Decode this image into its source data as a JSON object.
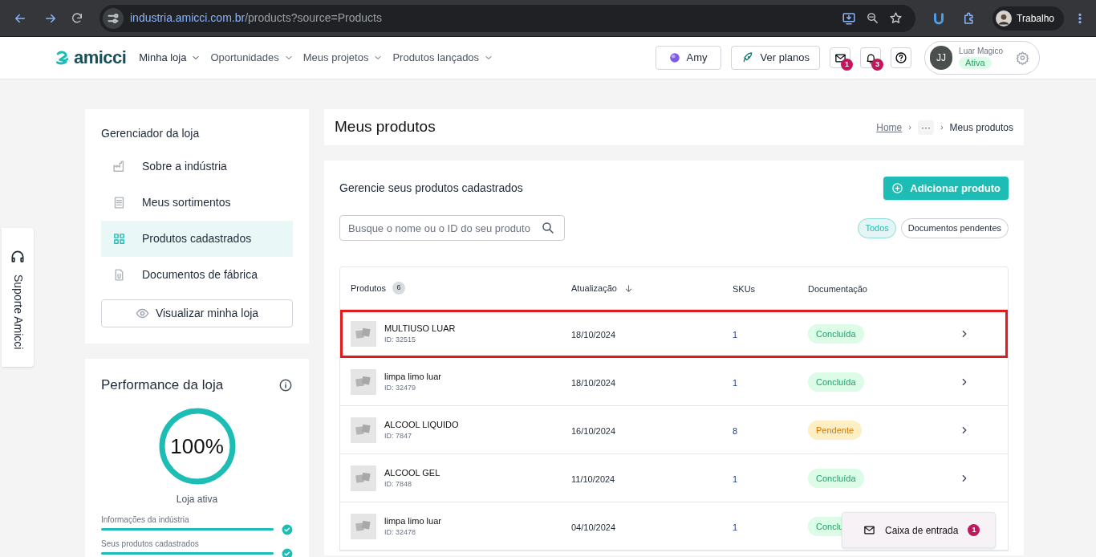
{
  "browser": {
    "url_host": "industria.amicci.com.br",
    "url_path": "/products?source=Products",
    "profile": "Trabalho"
  },
  "header": {
    "logo": "amicci",
    "nav": [
      {
        "label": "Minha loja",
        "selected": true
      },
      {
        "label": "Oportunidades",
        "selected": false
      },
      {
        "label": "Meus projetos",
        "selected": false
      },
      {
        "label": "Produtos lançados",
        "selected": false
      }
    ],
    "amy_button": "Amy",
    "plans_button": "Ver planos",
    "mail_badge": "1",
    "bell_badge": "3",
    "user": {
      "initials": "JJ",
      "name": "Luar Magico",
      "status": "Ativa"
    }
  },
  "support_tab": "Suporte Amicci",
  "store_manager": {
    "title": "Gerenciador da loja",
    "items": [
      {
        "label": "Sobre a indústria",
        "selected": false
      },
      {
        "label": "Meus sortimentos",
        "selected": false
      },
      {
        "label": "Produtos cadastrados",
        "selected": true
      },
      {
        "label": "Documentos de fábrica",
        "selected": false
      }
    ],
    "view_button": "Visualizar minha loja"
  },
  "performance": {
    "title": "Performance da loja",
    "percent": "100%",
    "caption": "Loja ativa",
    "items": [
      {
        "label": "Informações da indústria",
        "level": 1,
        "checked": true
      },
      {
        "label": "Seus produtos cadastrados",
        "level": 1,
        "checked": true
      }
    ]
  },
  "page": {
    "title": "Meus produtos",
    "breadcrumb": [
      "Home",
      "›",
      "···",
      "›",
      "Meus produtos"
    ]
  },
  "products": {
    "subtitle": "Gerencie seus produtos cadastrados",
    "add_button": "Adicionar produto",
    "search": {
      "placeholder": "Busque o nome ou o ID do seu produto"
    },
    "filters": [
      {
        "label": "Todos",
        "selected": true
      },
      {
        "label": "Documentos pendentes",
        "selected": false
      }
    ],
    "table": {
      "columns": [
        "Produtos",
        "Atualização",
        "SKUs",
        "Documentação"
      ],
      "count": "6",
      "rows": [
        {
          "name": "MULTIUSO LUAR",
          "id": "ID: 32515",
          "date": "18/10/2024",
          "skus": "1",
          "status": "Concluída",
          "kind": "done",
          "highlighted": true
        },
        {
          "name": "limpa limo luar",
          "id": "ID: 32479",
          "date": "18/10/2024",
          "skus": "1",
          "status": "Concluída",
          "kind": "done",
          "highlighted": false
        },
        {
          "name": "ALCOOL LIQUIDO",
          "id": "ID: 7847",
          "date": "16/10/2024",
          "skus": "8",
          "status": "Pendente",
          "kind": "pending",
          "highlighted": false
        },
        {
          "name": "ALCOOL GEL",
          "id": "ID: 7848",
          "date": "11/10/2024",
          "skus": "1",
          "status": "Concluída",
          "kind": "done",
          "highlighted": false
        },
        {
          "name": "limpa limo luar",
          "id": "ID: 32478",
          "date": "04/10/2024",
          "skus": "1",
          "status": "Conclu",
          "kind": "done",
          "highlighted": false,
          "covered": true
        }
      ]
    }
  },
  "inbox_popup": {
    "label": "Caixa de entrada",
    "badge": "1"
  }
}
